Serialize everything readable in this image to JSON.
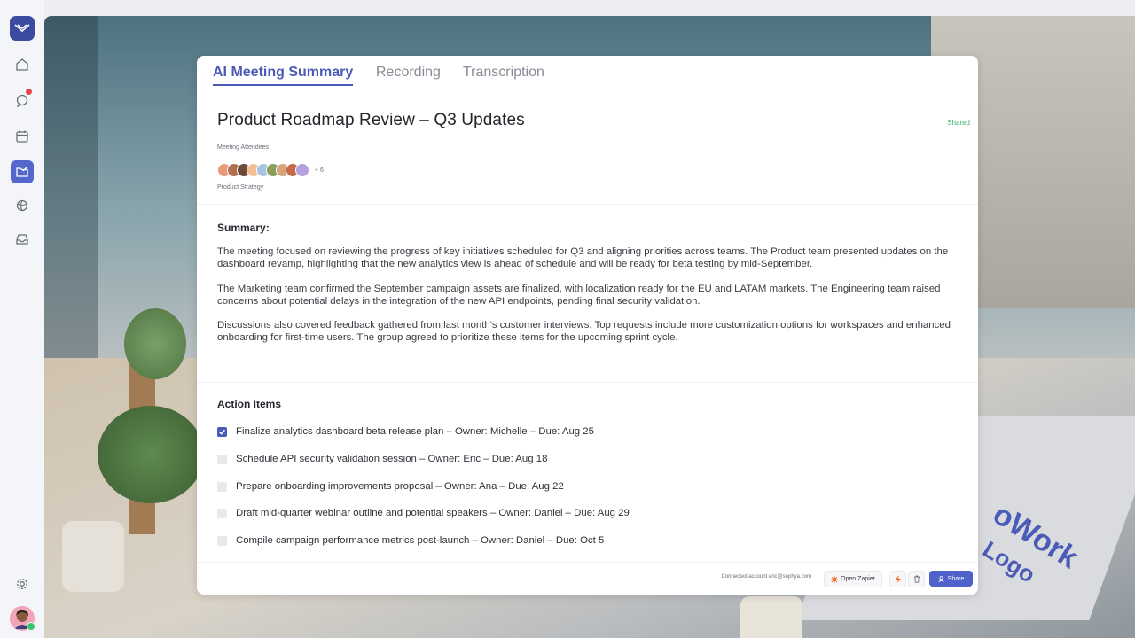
{
  "window": {
    "colors": [
      "#ee5f58",
      "#f6bd3f",
      "#3fc650"
    ]
  },
  "sidebar": {
    "items": [
      {
        "icon": "home-icon"
      },
      {
        "icon": "chat-icon",
        "badge": true
      },
      {
        "icon": "calendar-icon"
      },
      {
        "icon": "folder-icon",
        "active": true
      },
      {
        "icon": "globe-icon"
      },
      {
        "icon": "inbox-icon"
      }
    ],
    "settings_icon": "gear-icon",
    "user_avatar": "user-avatar"
  },
  "tabs": [
    {
      "label": "AI Meeting Summary",
      "active": true
    },
    {
      "label": "Recording",
      "active": false
    },
    {
      "label": "Transcription",
      "active": false
    }
  ],
  "meeting": {
    "title": "Product Roadmap Review – Q3 Updates",
    "status": "Shared",
    "attendees_label": "Meeting Attendees",
    "more_count": "+ 6",
    "team": "Product Strategy"
  },
  "summary": {
    "heading": "Summary:",
    "paragraphs": [
      "The meeting focused on reviewing the progress of key initiatives scheduled for Q3 and aligning priorities across teams. The Product team presented updates on the dashboard revamp, highlighting that the new analytics view is ahead of schedule and will be ready for beta testing by mid-September.",
      "The Marketing team confirmed the September campaign assets are finalized, with localization ready for the EU and LATAM markets. The Engineering team raised concerns about potential delays in the integration of the new API endpoints, pending final security validation.",
      "Discussions also covered feedback gathered from last month's customer interviews. Top requests include more customization options for workspaces and enhanced onboarding for first-time users. The group agreed to prioritize these items for the upcoming sprint cycle."
    ]
  },
  "actions": {
    "heading": "Action Items",
    "items": [
      {
        "text": "Finalize analytics dashboard beta release plan – Owner: Michelle – Due: Aug 25",
        "checked": true
      },
      {
        "text": "Schedule API security validation session – Owner: Eric – Due: Aug 18",
        "checked": false
      },
      {
        "text": "Prepare onboarding improvements proposal – Owner: Ana – Due: Aug 22",
        "checked": false
      },
      {
        "text": "Draft mid-quarter webinar outline and potential speakers – Owner: Daniel – Due: Aug 29",
        "checked": false
      },
      {
        "text": "Compile campaign performance metrics post-launch – Owner: Daniel – Due: Oct 5",
        "checked": false
      }
    ]
  },
  "footer": {
    "connected": "Connected account eric@sophya.com",
    "zapier_label": "Open Zapier",
    "share_label": "Share"
  },
  "background": {
    "logo_text_1": "oWork",
    "logo_text_2": "Logo"
  },
  "colors": {
    "accent": "#4a5ab5",
    "shared": "#36b26a",
    "badge": "#e8434b"
  }
}
